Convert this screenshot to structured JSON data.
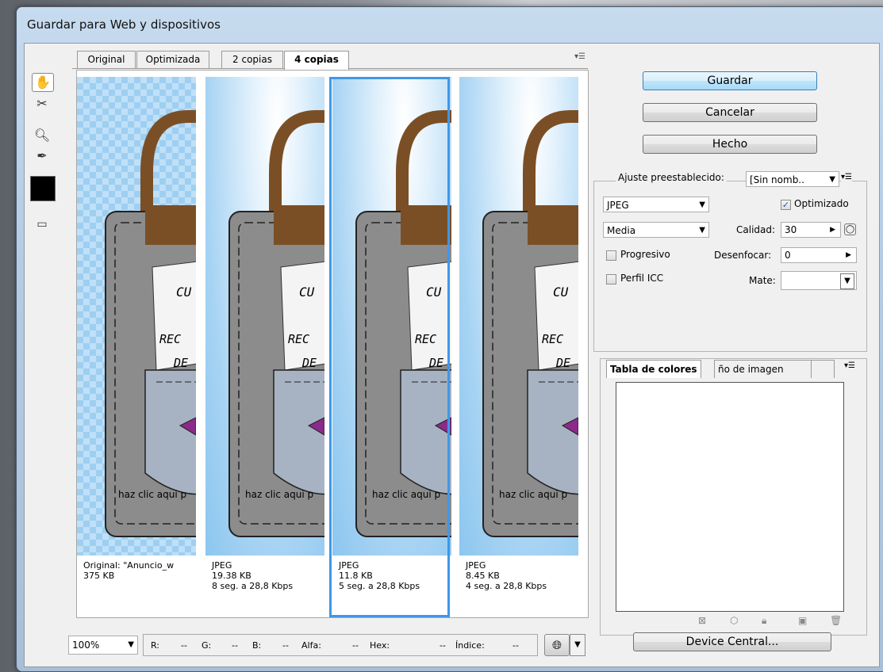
{
  "window": {
    "title": "Guardar para Web y dispositivos"
  },
  "tabs": [
    "Original",
    "Optimizada",
    "2 copias",
    "4 copias"
  ],
  "active_tab": "4 copias",
  "panes": [
    {
      "image_text": {
        "line1": "CU",
        "line2": "REC",
        "line3": "DE",
        "bottom": "haz clic aqui p"
      },
      "info_line1": "Original: \"Anuncio_w",
      "info_line2": "375 KB",
      "info_line3": ""
    },
    {
      "image_text": {
        "line1": "CU",
        "line2": "REC",
        "line3": "DE",
        "bottom": "haz clic aqui p"
      },
      "info_line1": "JPEG",
      "info_line2": "19.38 KB",
      "info_line3": "8 seg. a 28,8 Kbps"
    },
    {
      "image_text": {
        "line1": "CU",
        "line2": "REC",
        "line3": "DE",
        "bottom": "haz clic aqui p"
      },
      "info_line1": "JPEG",
      "info_line2": "11.8 KB",
      "info_line3": "5 seg. a 28,8 Kbps"
    },
    {
      "image_text": {
        "line1": "CU",
        "line2": "REC",
        "line3": "DE",
        "bottom": "haz clic aqui p"
      },
      "info_line1": "JPEG",
      "info_line2": "8.45 KB",
      "info_line3": "4 seg. a 28,8 Kbps"
    }
  ],
  "buttons": {
    "save": "Guardar",
    "cancel": "Cancelar",
    "done": "Hecho",
    "device_central": "Device Central..."
  },
  "settings": {
    "preset_label": "Ajuste preestablecido:",
    "preset_value": "[Sin nomb..",
    "format": "JPEG",
    "optimized_label": "Optimizado",
    "optimized_checked": true,
    "quality_preset": "Media",
    "quality_label": "Calidad:",
    "quality_value": "30",
    "progressive_label": "Progresivo",
    "blur_label": "Desenfocar:",
    "blur_value": "0",
    "icc_label": "Perfil ICC",
    "matte_label": "Mate:"
  },
  "color_panel": {
    "tab1": "Tabla de colores",
    "tab2": "ño de imagen"
  },
  "status": {
    "zoom": "100%",
    "r_label": "R:",
    "r_value": "--",
    "g_label": "G:",
    "g_value": "--",
    "b_label": "B:",
    "b_value": "--",
    "alpha_label": "Alfa:",
    "alpha_value": "--",
    "hex_label": "Hex:",
    "hex_value": "--",
    "index_label": "Índice:",
    "index_value": "--"
  },
  "colors": {
    "selection": "#3f97e8",
    "bag_handle": "#7b4f25",
    "bag_body": "#8c8c8c",
    "pocket": "#a7b3c2",
    "arrow": "#8a2a8a"
  }
}
